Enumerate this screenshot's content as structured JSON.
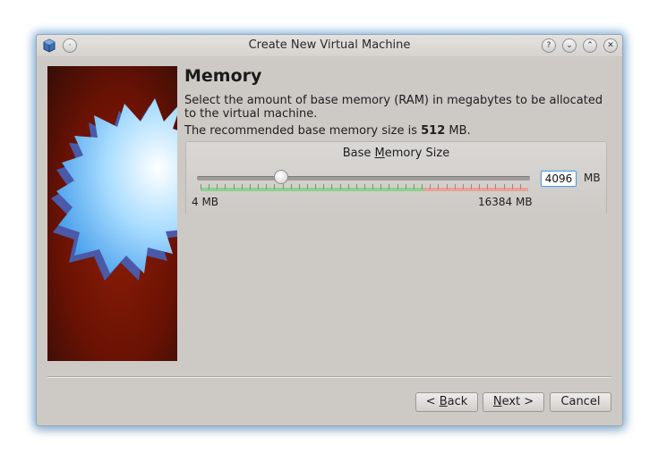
{
  "window": {
    "title": "Create New Virtual Machine"
  },
  "titlebar_buttons": [
    {
      "name": "help",
      "glyph": "?"
    },
    {
      "name": "minimize",
      "glyph": "⌄"
    },
    {
      "name": "maximize",
      "glyph": "⌃"
    },
    {
      "name": "close",
      "glyph": "✕"
    }
  ],
  "page": {
    "heading": "Memory",
    "description": "Select the amount of base memory (RAM) in megabytes to be allocated to the virtual machine.",
    "recommended_prefix": "The recommended base memory size is ",
    "recommended_value": "512",
    "recommended_suffix": " MB."
  },
  "memory": {
    "group_title_pre": "Base ",
    "group_title_mnemonic": "M",
    "group_title_post": "emory Size",
    "value": "4096",
    "unit": "MB",
    "min_label": "4 MB",
    "max_label": "16384 MB",
    "slider_fraction": 0.25
  },
  "buttons": {
    "back_pre": "< ",
    "back_mnemonic": "B",
    "back_post": "ack",
    "next_mnemonic": "N",
    "next_post": "ext >",
    "cancel": "Cancel"
  },
  "colors": {
    "window_bg": "#cdcac6",
    "focus_glow": "#4696dc",
    "tick_safe": "#8fd08f",
    "tick_warn": "#e8a29a"
  }
}
